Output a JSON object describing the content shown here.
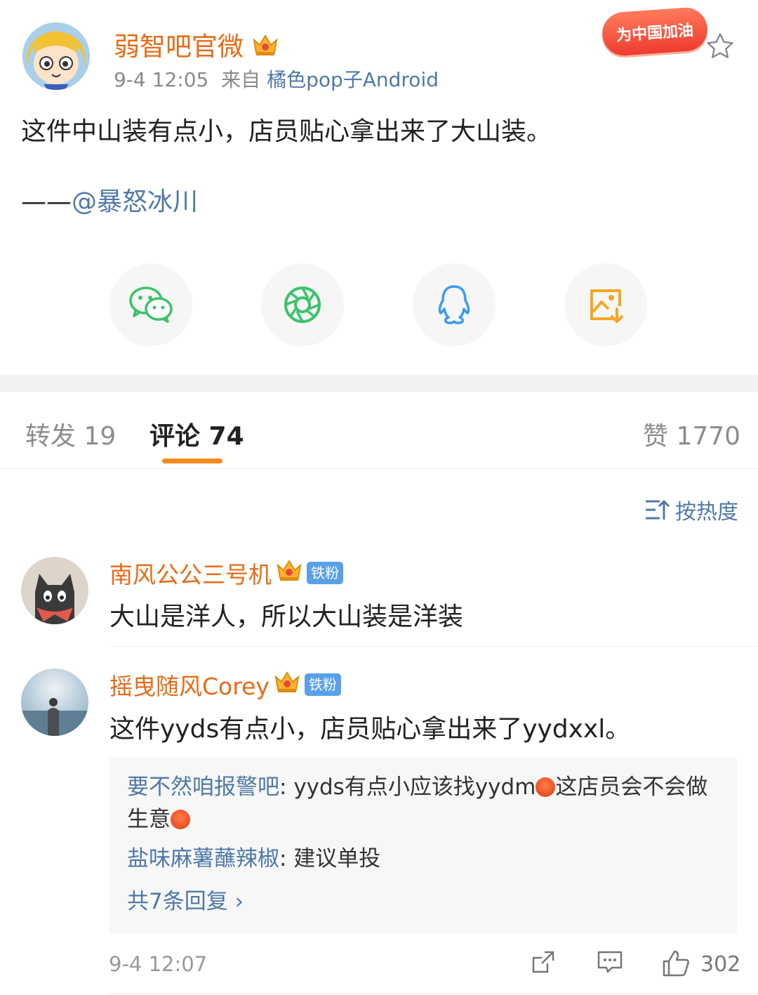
{
  "post": {
    "author": "弱智吧官微",
    "time": "9-4 12:05",
    "source_prefix": "来自",
    "source": "橘色pop子Android",
    "badge_text": "为中国加油",
    "text": "这件中山装有点小，店员贴心拿出来了大山装。",
    "credit_dash": "——",
    "credit_mention": "@暴怒冰川"
  },
  "share": [
    {
      "name": "wechat",
      "icon": "wechat-icon",
      "color": "#3cc36a"
    },
    {
      "name": "moments",
      "icon": "moments-icon",
      "color": "#3cc36a"
    },
    {
      "name": "qq",
      "icon": "qq-icon",
      "color": "#3a9bf2"
    },
    {
      "name": "save-image",
      "icon": "save-image-icon",
      "color": "#f5a623"
    }
  ],
  "tabs": {
    "repost": "转发 19",
    "comments": "评论 74",
    "likes": "赞 1770"
  },
  "sort_label": "按热度",
  "comments": [
    {
      "name": "南风公公三号机",
      "badge": "铁粉",
      "text": "大山是洋人，所以大山装是洋装"
    },
    {
      "name": "摇曳随风Corey",
      "badge": "铁粉",
      "text": "这件yyds有点小，店员贴心拿出来了yydxxl。",
      "replies": [
        {
          "name": "要不然咱报警吧",
          "sep": ": ",
          "text_a": "yyds有点小应该找yydm",
          "text_b": "这店员会不会做生意"
        },
        {
          "name": "盐味麻薯蘸辣椒",
          "sep": ": ",
          "text": "建议单投"
        }
      ],
      "more_replies": "共7条回复 ›",
      "time": "9-4 12:07",
      "likes": "302"
    }
  ],
  "colors": {
    "accent_orange": "#e86b15",
    "link_blue": "#4f79a8",
    "tab_underline": "#f28a1f"
  }
}
